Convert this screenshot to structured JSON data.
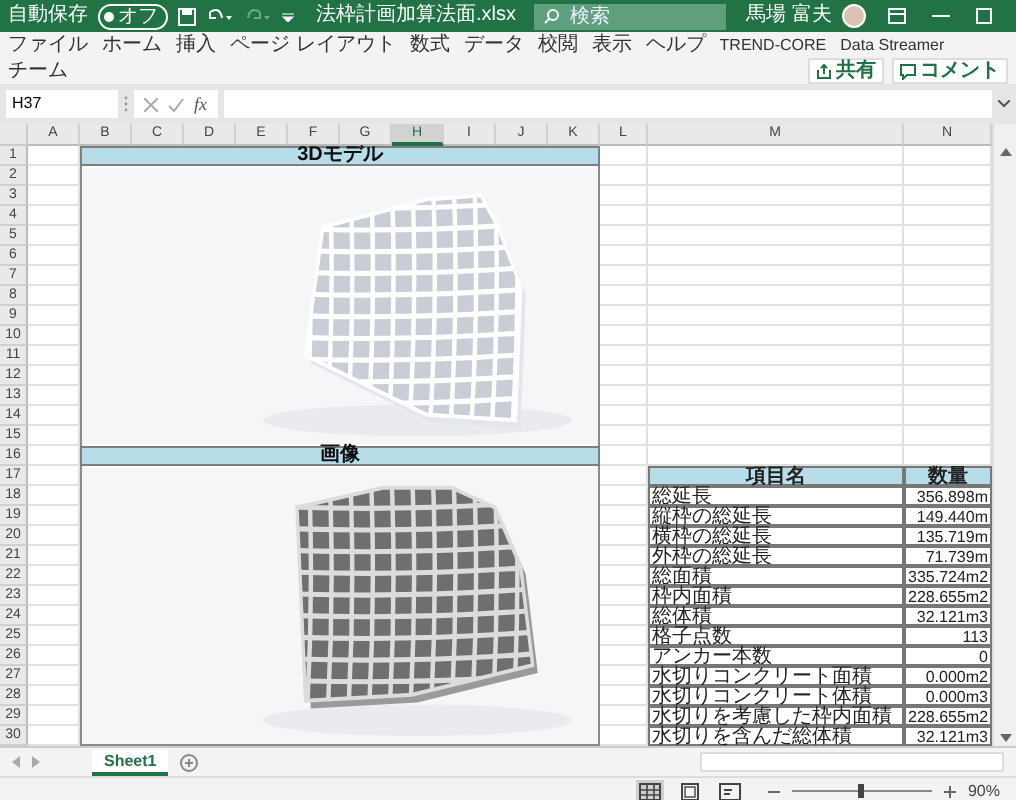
{
  "title_bar": {
    "autosave_label": "自動保存",
    "autosave": {
      "on": false,
      "label": "オフ"
    },
    "filename": "法枠計画加算法面.xlsx",
    "search": {
      "placeholder": "検索"
    },
    "user": "馬場 富夫"
  },
  "ribbon": {
    "tabs": [
      {
        "label": "ファイル",
        "selected": false
      },
      {
        "label": "ホーム",
        "selected": false
      },
      {
        "label": "挿入",
        "selected": false
      },
      {
        "label": "ページ レイアウト",
        "selected": false
      },
      {
        "label": "数式",
        "selected": false
      },
      {
        "label": "データ",
        "selected": false
      },
      {
        "label": "校閲",
        "selected": false
      },
      {
        "label": "表示",
        "selected": false
      },
      {
        "label": "ヘルプ",
        "selected": false
      },
      {
        "label": "TREND-CORE",
        "selected": false
      },
      {
        "label": "Data Streamer",
        "selected": false
      },
      {
        "label": "チーム",
        "selected": false
      }
    ],
    "share": "共有",
    "comment": "コメント"
  },
  "formula_bar": {
    "name_box": "H37",
    "fx": "fx"
  },
  "sheet": {
    "columns": [
      {
        "label": "A",
        "selected": false
      },
      {
        "label": "B",
        "selected": false
      },
      {
        "label": "C",
        "selected": false
      },
      {
        "label": "D",
        "selected": false
      },
      {
        "label": "E",
        "selected": false
      },
      {
        "label": "F",
        "selected": false
      },
      {
        "label": "G",
        "selected": false
      },
      {
        "label": "H",
        "selected": true
      },
      {
        "label": "I",
        "selected": false
      },
      {
        "label": "J",
        "selected": false
      },
      {
        "label": "K",
        "selected": false
      },
      {
        "label": "L",
        "selected": false
      },
      {
        "label": "M",
        "selected": false
      },
      {
        "label": "N",
        "selected": false
      }
    ],
    "rows": [
      "1",
      "2",
      "3",
      "4",
      "5",
      "6",
      "7",
      "8",
      "9",
      "10",
      "11",
      "12",
      "13",
      "14",
      "15",
      "16",
      "17",
      "18",
      "19",
      "20",
      "21",
      "22",
      "23",
      "24",
      "25",
      "26",
      "27",
      "28",
      "29",
      "30"
    ],
    "sections": [
      {
        "title": "3Dモデル",
        "kind": "picture"
      },
      {
        "title": "画像",
        "kind": "picture"
      }
    ],
    "table": {
      "columns": [
        "項目名",
        "数量"
      ],
      "rows": [
        [
          "総延長",
          "356.898m"
        ],
        [
          "縦枠の総延長",
          "149.440m"
        ],
        [
          "横枠の総延長",
          "135.719m"
        ],
        [
          "外枠の総延長",
          "71.739m"
        ],
        [
          "総面積",
          "335.724m2"
        ],
        [
          "枠内面積",
          "228.655m2"
        ],
        [
          "総体積",
          "32.121m3"
        ],
        [
          "格子点数",
          "113"
        ],
        [
          "アンカー本数",
          "0"
        ],
        [
          "水切りコンクリート面積",
          "0.000m2"
        ],
        [
          "水切りコンクリート体積",
          "0.000m3"
        ],
        [
          "水切りを考慮した枠内面積",
          "228.655m2"
        ],
        [
          "水切りを含んだ総体積",
          "32.121m3"
        ]
      ]
    }
  },
  "sheet_tabs": [
    {
      "label": "Sheet1",
      "selected": true
    }
  ],
  "status_bar": {
    "view_modes": [
      {
        "kind": "normal",
        "selected": true
      },
      {
        "kind": "page_layout",
        "selected": false
      },
      {
        "kind": "page_break",
        "selected": false
      }
    ],
    "zoom": {
      "level": 0.5,
      "reading": "90%"
    }
  }
}
